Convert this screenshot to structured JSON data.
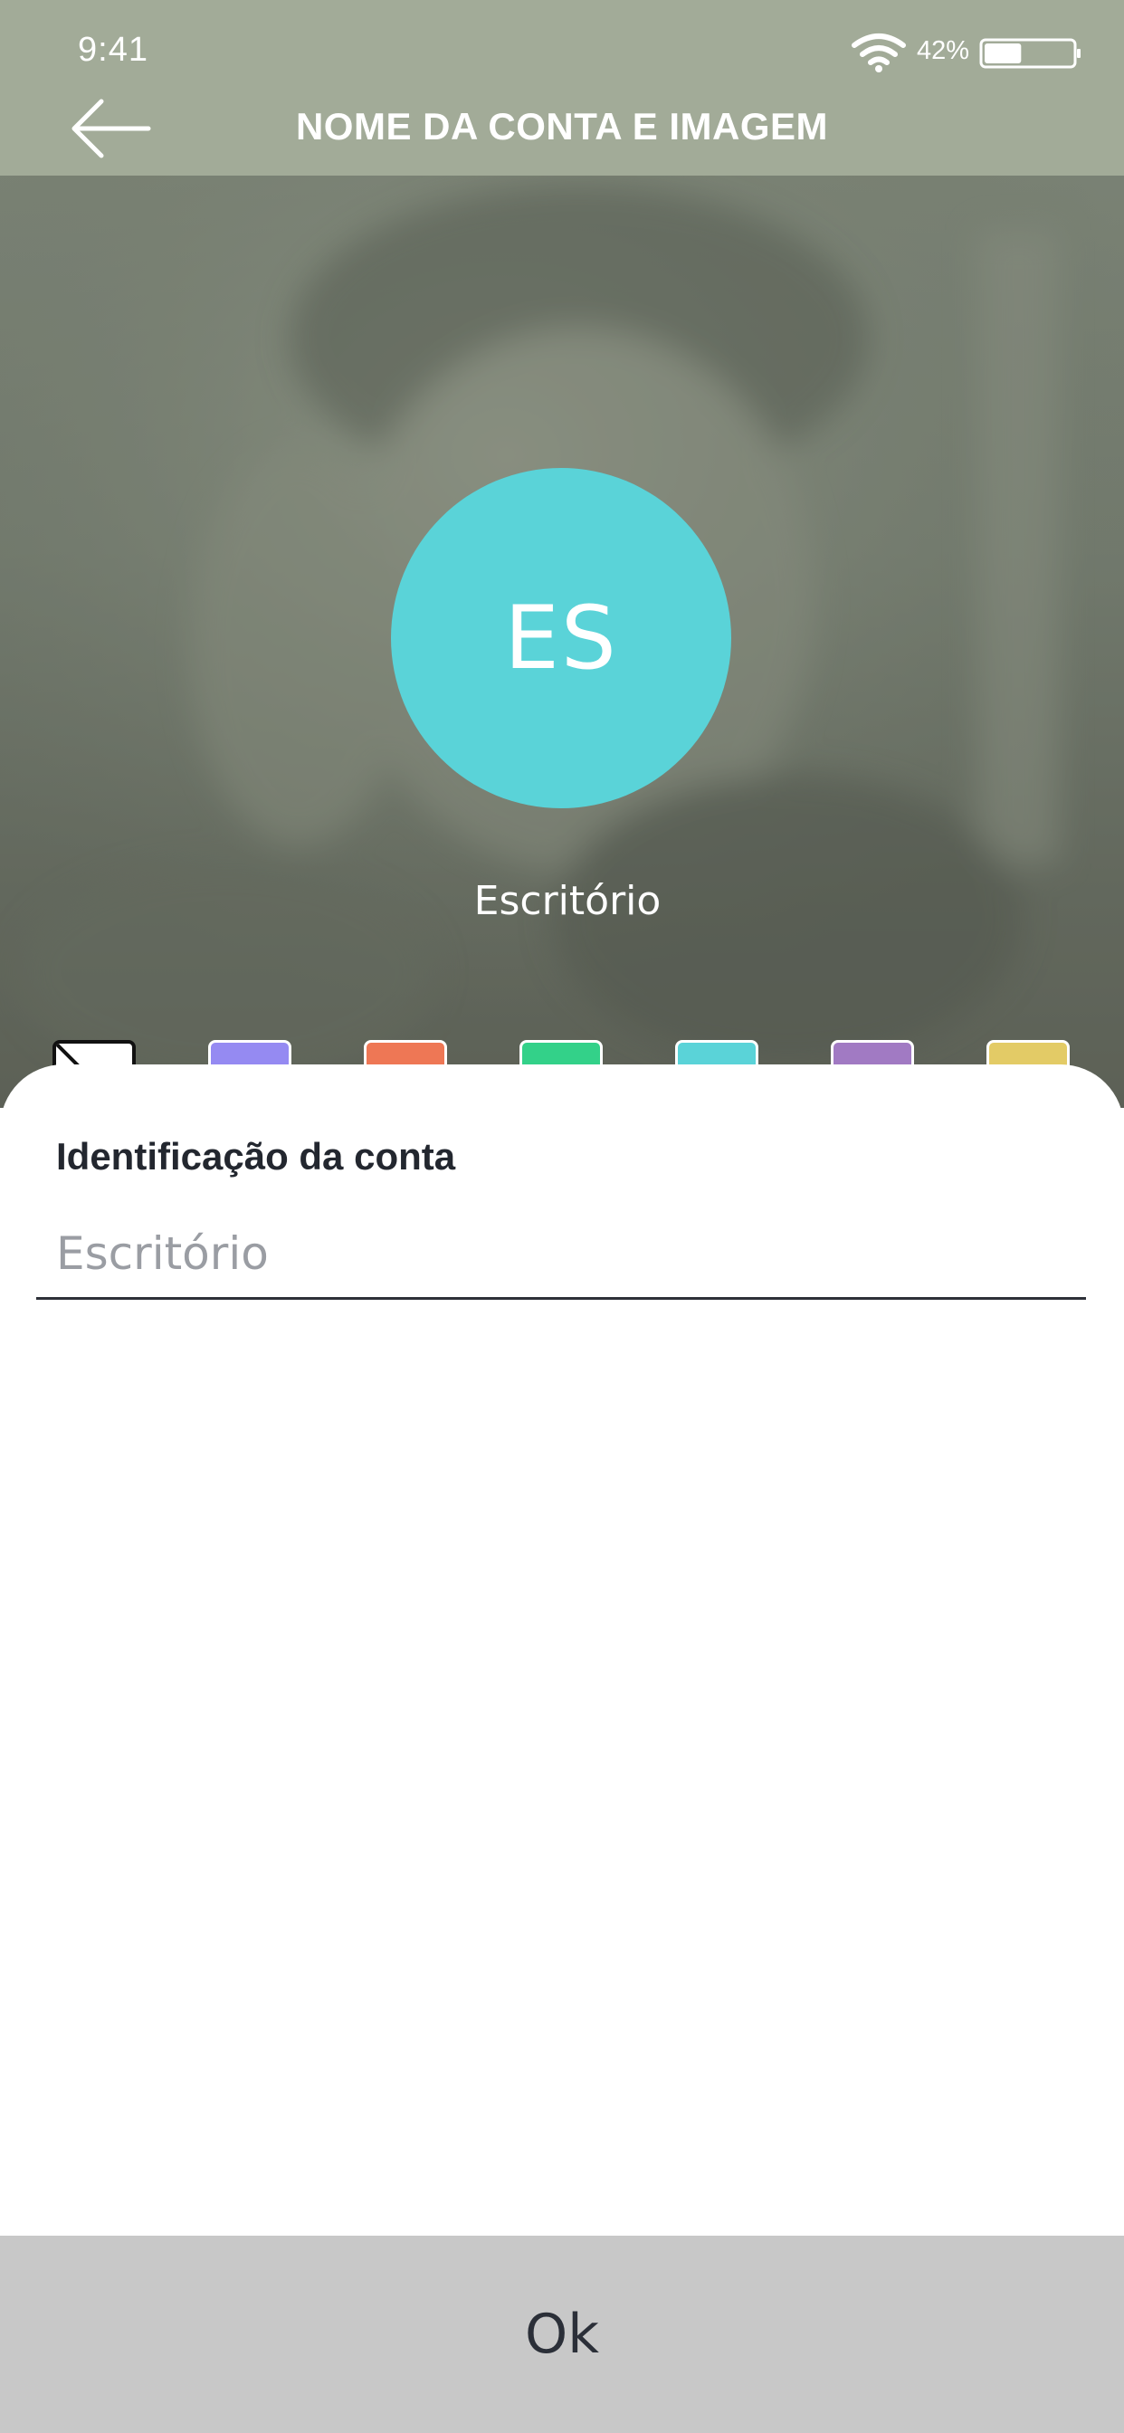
{
  "status_bar": {
    "time": "9:41",
    "battery_percent": "42%",
    "battery_level": 0.42,
    "icons": [
      "wifi-icon",
      "battery-icon"
    ]
  },
  "header": {
    "back_icon": "arrow-left-icon",
    "title": "NOME DA CONTA E IMAGEM",
    "background_color": "#a2ab98"
  },
  "profile": {
    "initials": "ES",
    "name": "Escritório",
    "avatar_color": "#5ad3d8"
  },
  "color_swatches": [
    {
      "id": "none",
      "color": "#ffffff",
      "label_icon": "no-color-icon"
    },
    {
      "id": "lavender",
      "color": "#958af2"
    },
    {
      "id": "coral",
      "color": "#ee7755"
    },
    {
      "id": "green",
      "color": "#33d189"
    },
    {
      "id": "cyan",
      "color": "#5ad3d8"
    },
    {
      "id": "purple",
      "color": "#a17ac3"
    },
    {
      "id": "yellow",
      "color": "#e3cb66"
    }
  ],
  "form": {
    "label": "Identificação da conta",
    "value": "",
    "placeholder": "Escritório"
  },
  "ok_button": {
    "label": "Ok",
    "background_color": "#c8c8c8"
  }
}
